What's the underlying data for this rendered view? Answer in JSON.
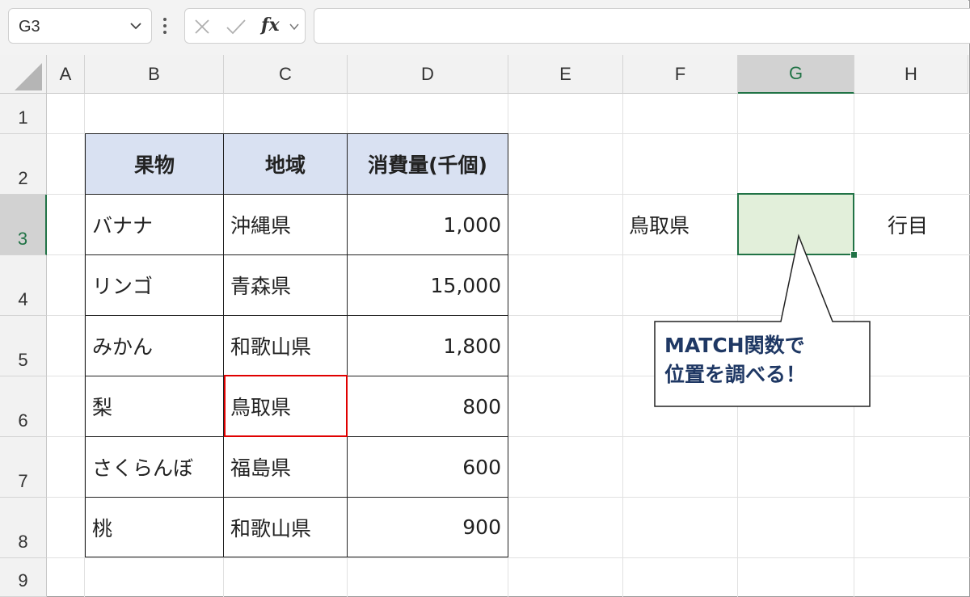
{
  "formula_bar": {
    "name_box": "G3",
    "formula": ""
  },
  "columns": [
    "A",
    "B",
    "C",
    "D",
    "E",
    "F",
    "G",
    "H"
  ],
  "rows": [
    "1",
    "2",
    "3",
    "4",
    "5",
    "6",
    "7",
    "8",
    "9"
  ],
  "selected_cell": {
    "column": "G",
    "row": "3"
  },
  "table": {
    "headers": [
      "果物",
      "地域",
      "消費量(千個)"
    ],
    "rows": [
      [
        "バナナ",
        "沖縄県",
        "1,000"
      ],
      [
        "リンゴ",
        "青森県",
        "15,000"
      ],
      [
        "みかん",
        "和歌山県",
        "1,800"
      ],
      [
        "梨",
        "鳥取県",
        "800"
      ],
      [
        "さくらんぼ",
        "福島県",
        "600"
      ],
      [
        "桃",
        "和歌山県",
        "900"
      ]
    ]
  },
  "lookup": {
    "value": "鳥取県",
    "result": "",
    "suffix": "行目"
  },
  "callout": {
    "line1": "MATCH関数で",
    "line2": "位置を調べる！"
  },
  "colors": {
    "accent_green": "#217346",
    "selected_fill": "#e2efda",
    "header_fill": "#d9e1f2",
    "highlight_red": "#e00000"
  }
}
